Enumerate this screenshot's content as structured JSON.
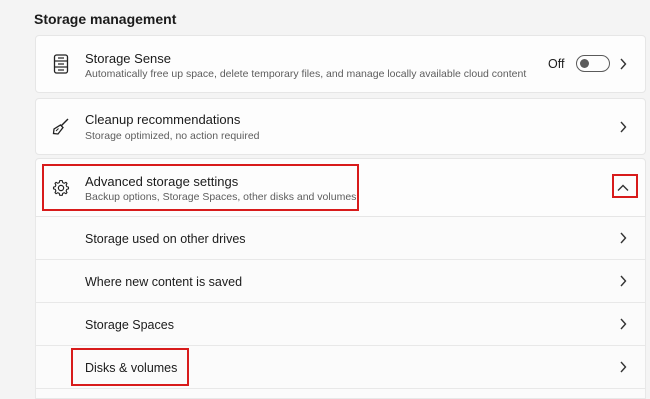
{
  "section": {
    "title": "Storage management"
  },
  "storage_sense": {
    "title": "Storage Sense",
    "description": "Automatically free up space, delete temporary files, and manage locally available cloud content",
    "toggle_label": "Off",
    "toggle_on": false,
    "icon": "storage-drive-icon"
  },
  "cleanup": {
    "title": "Cleanup recommendations",
    "description": "Storage optimized, no action required",
    "icon": "broom-icon"
  },
  "advanced": {
    "title": "Advanced storage settings",
    "description": "Backup options, Storage Spaces, other disks and volumes",
    "icon": "gear-icon",
    "expanded": true
  },
  "advanced_items": [
    {
      "label": "Storage used on other drives"
    },
    {
      "label": "Where new content is saved"
    },
    {
      "label": "Storage Spaces"
    },
    {
      "label": "Disks & volumes"
    }
  ],
  "colors": {
    "highlight": "#d81b1b",
    "background": "#f4f4f4",
    "card": "#fdfdfd"
  }
}
